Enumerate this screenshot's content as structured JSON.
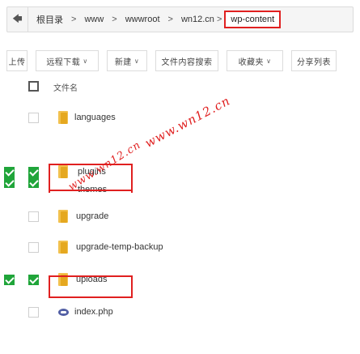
{
  "address_bar": {
    "back_icon": "back-arrow-icon",
    "breadcrumbs": [
      "根目录",
      "www",
      "wwwroot",
      "wn12.cn"
    ],
    "current": "wp-content",
    "separator": ">"
  },
  "toolbar": {
    "buttons": [
      {
        "label": "上传",
        "caret": false
      },
      {
        "label": "远程下载",
        "caret": true
      },
      {
        "label": "新建",
        "caret": true
      },
      {
        "label": "文件内容搜索",
        "caret": false
      },
      {
        "label": "收藏夹",
        "caret": true
      },
      {
        "label": "分享列表",
        "caret": false
      }
    ],
    "caret_glyph": "∨"
  },
  "list_header": {
    "title": "文件名"
  },
  "files": [
    {
      "name": "languages",
      "type": "folder",
      "checked": false
    },
    {
      "name": "plugins",
      "type": "folder",
      "checked": true
    },
    {
      "name": "themes",
      "type": "folder",
      "checked": true
    },
    {
      "name": "upgrade",
      "type": "folder",
      "checked": false
    },
    {
      "name": "upgrade-temp-backup",
      "type": "folder",
      "checked": false
    },
    {
      "name": "uploads",
      "type": "folder",
      "checked": true
    },
    {
      "name": "index.php",
      "type": "php",
      "checked": false
    }
  ],
  "watermarks": [
    "www.wn12.cn",
    "www.wn12.cn"
  ],
  "colors": {
    "accent": "#20a53a",
    "highlight": "#e02020",
    "folder": "#f2c14e"
  }
}
